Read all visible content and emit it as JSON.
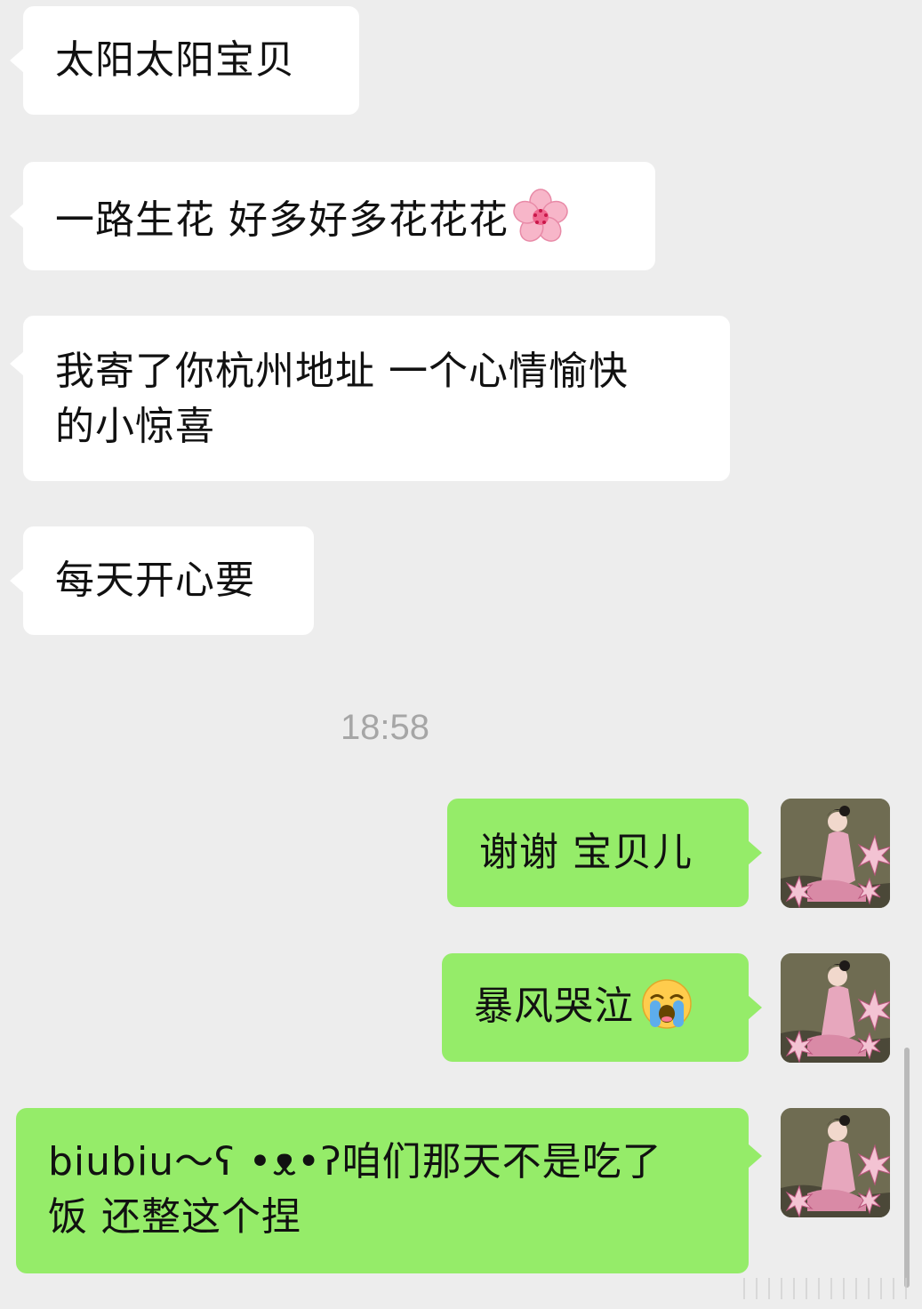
{
  "messages_in": [
    {
      "text": "太阳太阳宝贝"
    },
    {
      "text": "一路生花 好多好多花花花",
      "emoji": "cherry-blossom"
    },
    {
      "text_line1": "我寄了你杭州地址 一个心情愉快",
      "text_line2": "的小惊喜"
    },
    {
      "text": "每天开心要"
    }
  ],
  "timestamp": "18:58",
  "messages_out": [
    {
      "text": "谢谢 宝贝儿"
    },
    {
      "text": "暴风哭泣",
      "emoji": "loudly-crying-face"
    },
    {
      "text_line1": "biubiu～ʕ •ᴥ•ʔ咱们那天不是吃了",
      "text_line2": "饭 还整这个捏"
    }
  ],
  "colors": {
    "background": "#ededed",
    "incoming_bubble": "#ffffff",
    "outgoing_bubble": "#95ec69",
    "timestamp": "#a6a6a6"
  }
}
